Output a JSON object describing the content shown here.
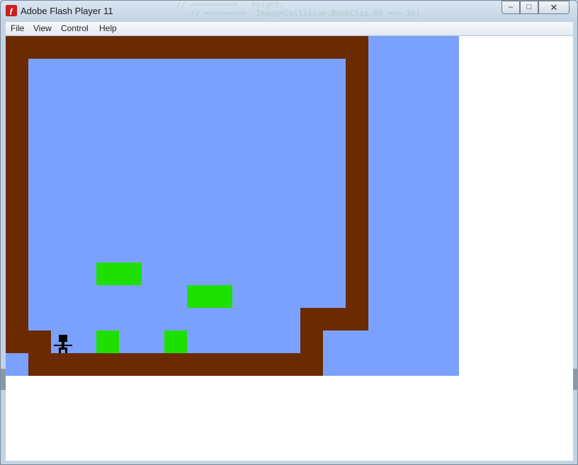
{
  "window": {
    "title": "Adobe Flash Player 11",
    "ghost_text": "// ==========   height;\n   // =========  Image=Collision.BackClip.00 === 16)",
    "controls": {
      "minimize": "–",
      "maximize": "□",
      "close": "✕"
    }
  },
  "menu": {
    "items": [
      "File",
      "View",
      "Control",
      "Help"
    ]
  },
  "game": {
    "colors": {
      "sky": "#7ba1ff",
      "wall": "#6b2a00",
      "block": "#1ee000",
      "player": "#000000",
      "background": "#ffffff"
    },
    "player": {
      "icon": "stick-figure-icon"
    },
    "block_count": 4
  }
}
